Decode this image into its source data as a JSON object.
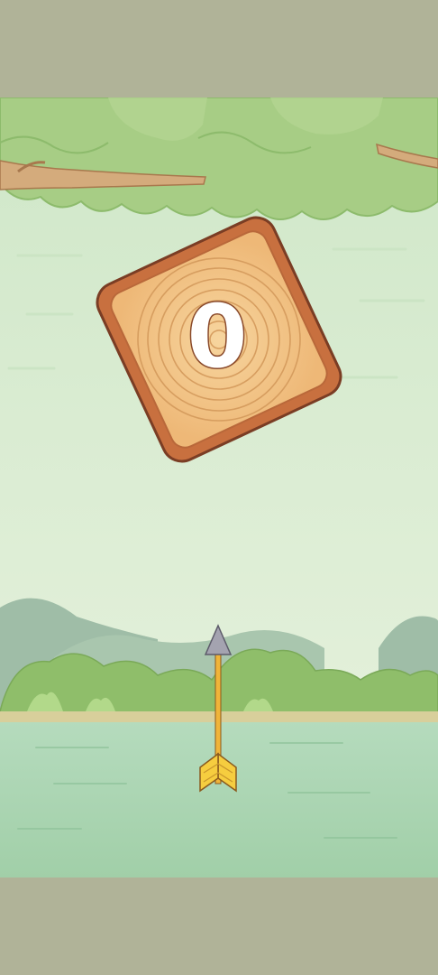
{
  "game": {
    "score": "0"
  },
  "colors": {
    "letterbox": "#b0b398",
    "sky_top": "#d6ead0",
    "sky_bottom": "#e6f1dc",
    "canopy": "#a9cf87",
    "canopy_dark": "#8dbb6c",
    "branch": "#cfa474",
    "wood_face": "#f2c488",
    "wood_rim": "#c06a3c",
    "wood_outline": "#7a3d24",
    "ring": "#d39a5d",
    "score_fill": "#ffffff",
    "score_stroke": "#8a4a2b",
    "hills": "#9dbaa3",
    "bushes": "#93c06d",
    "shore": "#d7cd9a",
    "water": "#a8d3b0",
    "arrow_shaft": "#f0b43a",
    "arrow_tip": "#9b9aa6",
    "arrow_feathers": "#f6cd3f"
  },
  "icons": {
    "target": "wood-log-target-icon",
    "arrow": "arrow-icon"
  }
}
